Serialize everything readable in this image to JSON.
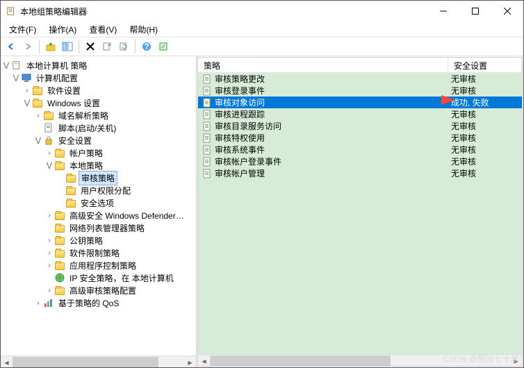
{
  "window": {
    "title": "本地组策略编辑器"
  },
  "menu": {
    "file": "文件(F)",
    "action": "操作(A)",
    "view": "查看(V)",
    "help": "帮助(H)"
  },
  "tree": {
    "root": "本地计算机 策略",
    "computer": "计算机配置",
    "soft": "软件设置",
    "win": "Windows 设置",
    "dns": "域名解析策略",
    "scripts": "脚本(启动/关机)",
    "sec": "安全设置",
    "acct": "帐户策略",
    "local": "本地策略",
    "audit": "审核策略",
    "rights": "用户权限分配",
    "secopt": "安全选项",
    "defender": "高级安全 Windows Defender…",
    "netlist": "网络列表管理器策略",
    "pubkey": "公钥策略",
    "softrestrict": "软件限制策略",
    "appctrl": "应用程序控制策略",
    "ipsec": "IP 安全策略，在 本地计算机",
    "advaudit": "高级审核策略配置",
    "qos": "基于策略的 QoS"
  },
  "list": {
    "col_policy": "策略",
    "col_security": "安全设置",
    "rows": [
      {
        "name": "审核策略更改",
        "val": "无审核",
        "sel": false
      },
      {
        "name": "审核登录事件",
        "val": "无审核",
        "sel": false
      },
      {
        "name": "审核对象访问",
        "val": "成功, 失败",
        "sel": true
      },
      {
        "name": "审核进程跟踪",
        "val": "无审核",
        "sel": false
      },
      {
        "name": "审核目录服务访问",
        "val": "无审核",
        "sel": false
      },
      {
        "name": "审核特权使用",
        "val": "无审核",
        "sel": false
      },
      {
        "name": "审核系统事件",
        "val": "无审核",
        "sel": false
      },
      {
        "name": "审核帐户登录事件",
        "val": "无审核",
        "sel": false
      },
      {
        "name": "审核帐户管理",
        "val": "无审核",
        "sel": false
      }
    ]
  },
  "watermark": "CSDN @阳光七十米"
}
